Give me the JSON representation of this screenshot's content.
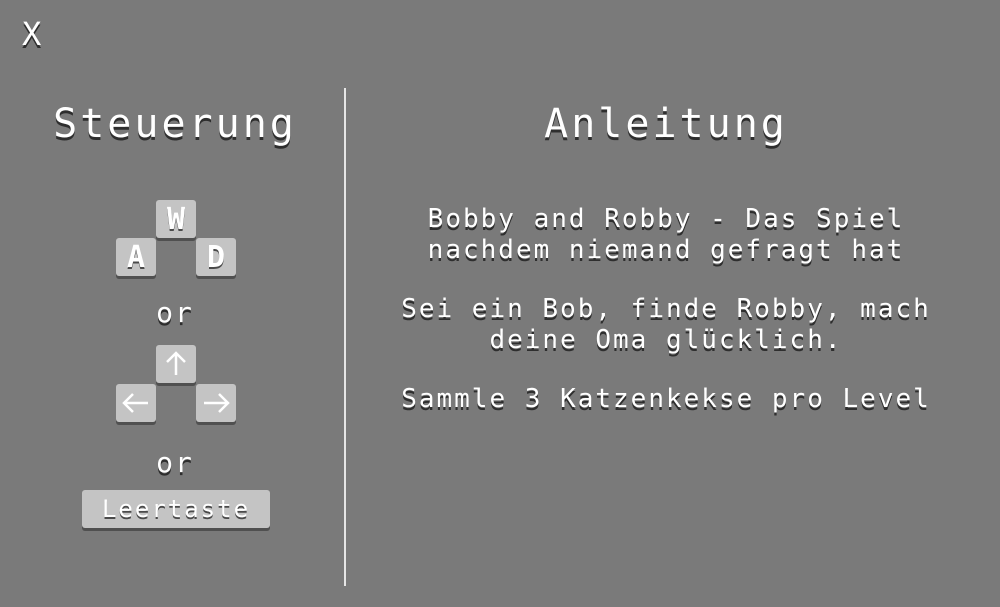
{
  "close": {
    "label": "X"
  },
  "controls": {
    "title": "Steuerung",
    "wasd_keys": {
      "up": "W",
      "left": "A",
      "right": "D"
    },
    "arrow_keys": {
      "up": "up-arrow-icon",
      "left": "left-arrow-icon",
      "right": "right-arrow-icon"
    },
    "or_1": "or",
    "or_2": "or",
    "space_label": "Leertaste"
  },
  "instructions": {
    "title": "Anleitung",
    "paragraph_1_line_1": "Bobby and Robby - Das Spiel",
    "paragraph_1_line_2": "nachdem niemand gefragt hat",
    "paragraph_2_line_1": "Sei ein Bob, finde Robby, mach",
    "paragraph_2_line_2": "deine Oma glücklich.",
    "paragraph_3": "Sammle 3 Katzenkekse pro Level"
  },
  "colors": {
    "background": "#7a7a7a",
    "key": "#c4c4c4",
    "text": "#ffffff",
    "divider": "#e6e6e6"
  }
}
